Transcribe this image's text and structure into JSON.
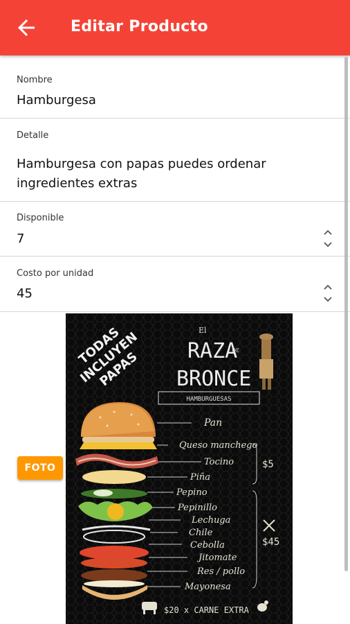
{
  "header": {
    "title": "Editar Producto"
  },
  "form": {
    "nombre": {
      "label": "Nombre",
      "value": "Hamburgesa"
    },
    "detalle": {
      "label": "Detalle",
      "value_line1": "Hamburgesa con papas puedes ordenar",
      "value_line2": "ingredientes extras"
    },
    "disponible": {
      "label": "Disponible",
      "value": "7"
    },
    "costo": {
      "label": "Costo por unidad",
      "value": "45"
    }
  },
  "photo_button": {
    "label": "FOTO"
  },
  "poster": {
    "banner": [
      "TODAS",
      "INCLUYEN",
      "PAPAS"
    ],
    "brand_prefix": "El",
    "brand_line1": "RAZA",
    "brand_small": "DE",
    "brand_line2": "BRONCE",
    "brand_sub": "HAMBURGUESAS",
    "ingredients": [
      "Pan",
      "Queso manchego",
      "Tocino",
      "Piña",
      "Pepino",
      "Pepinillo",
      "Lechuga",
      "Chile",
      "Cebolla",
      "Jitomate",
      "Res / pollo",
      "Mayonesa"
    ],
    "price_small": "$5",
    "price_big": "$45",
    "footer": "$20 x CARNE EXTRA"
  },
  "colors": {
    "appbar": "#f44336",
    "photo_button": "#ff9800",
    "divider": "#d6d6d6"
  }
}
